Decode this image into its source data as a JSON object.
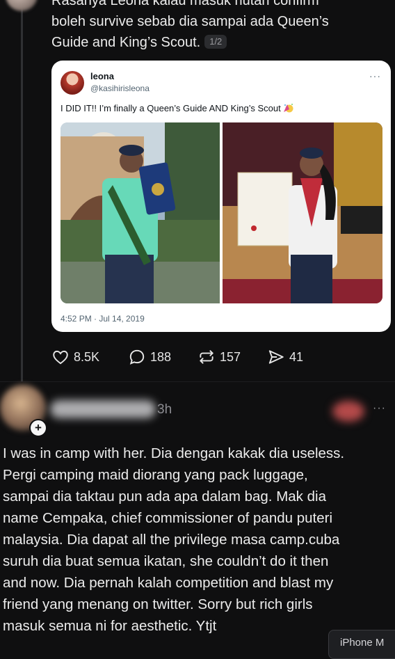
{
  "post": {
    "lines": [
      "Rasanya Leona kalau masuk hutan confirm",
      "boleh survive sebab dia sampai ada Queen’s",
      "Guide and King’s Scout."
    ],
    "page_badge": "1/2"
  },
  "tweet": {
    "name": "leona",
    "handle": "@kasihirisleona",
    "more": "···",
    "text": "I DID IT!! I’m finally a Queen’s Guide AND King’s Scout",
    "emoji": "party-face-emoji",
    "time": "4:52 PM · Jul 14, 2019"
  },
  "actions": {
    "likes": "8.5K",
    "replies": "188",
    "reposts": "157",
    "shares": "41"
  },
  "comment": {
    "time": "3h",
    "more": "···",
    "plus": "+",
    "lines": [
      "I was in camp with her. Dia dengan kakak dia useless.",
      "Pergi camping maid diorang yang pack luggage,",
      "sampai dia taktau pun ada apa dalam bag. Mak dia",
      "name Cempaka, chief commissioner of pandu puteri",
      "malaysia. Dia dapat all the privilege masa camp.cuba",
      "suruh dia buat semua ikatan, she couldn’t do it then",
      "and now. Dia pernah kalah competition and blast my",
      "friend yang menang on twitter. Sorry but rich girls",
      "masuk semua ni for aesthetic. Ytjt"
    ]
  },
  "device_tag": "iPhone M",
  "colors": {
    "background": "#0f0f10",
    "card": "#ffffff",
    "muted": "#8d8d92"
  }
}
